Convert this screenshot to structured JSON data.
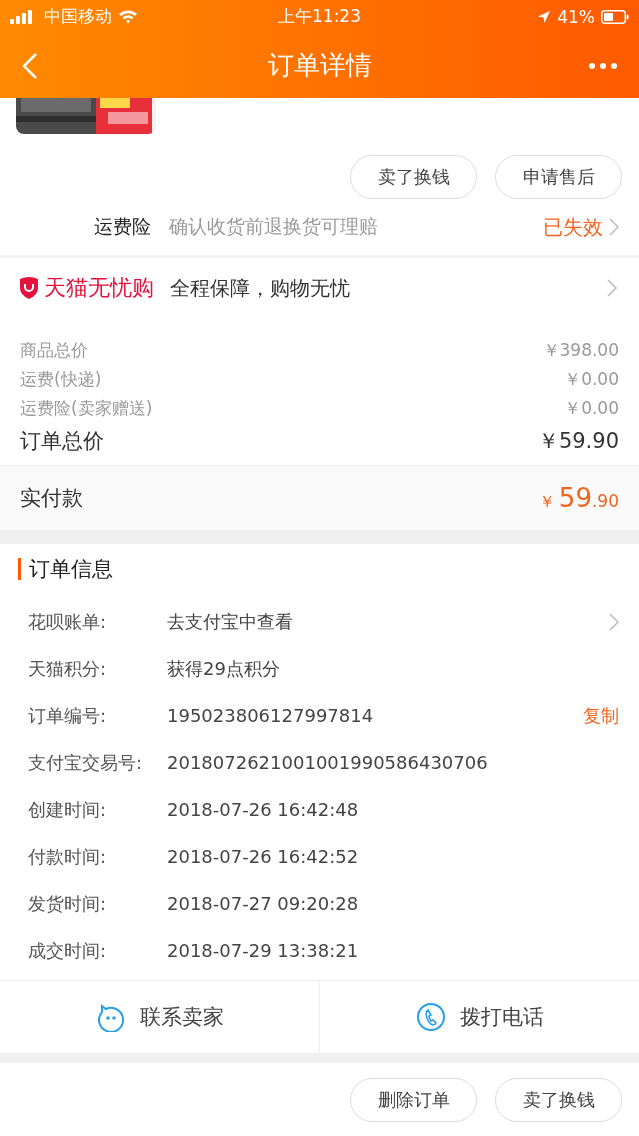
{
  "status_bar": {
    "carrier": "中国移动",
    "time": "上午11:23",
    "battery": "41%"
  },
  "nav": {
    "title": "订单详情"
  },
  "product": {
    "kind": "picture"
  },
  "actions": [
    "卖了换钱",
    "申请售后"
  ],
  "insurance": {
    "label": "运费险",
    "description": "确认收货前退换货可理赔",
    "status": "已失效"
  },
  "guarantee": {
    "brand": "天猫无忧购",
    "slogan": "全程保障，购物无忧"
  },
  "price_lines": [
    {
      "label": "商品总价",
      "value": "￥398.00"
    },
    {
      "label": "运费(快递)",
      "value": "￥0.00"
    },
    {
      "label": "运费险(卖家赠送)",
      "value": "￥0.00"
    }
  ],
  "order_total": {
    "label": "订单总价",
    "value": "￥59.90"
  },
  "paid": {
    "label": "实付款",
    "currency": "￥",
    "integer": "59",
    "decimal": ".90"
  },
  "order_info": {
    "title": "订单信息",
    "rows": [
      {
        "label": "花呗账单:",
        "value": "去支付宝中查看",
        "kind": "link"
      },
      {
        "label": "天猫积分:",
        "value": "获得29点积分",
        "kind": "plain"
      },
      {
        "label": "订单编号:",
        "value": "195023806127997814",
        "kind": "copy",
        "action": "复制"
      },
      {
        "label": "支付宝交易号:",
        "value": "2018072621001001990586430706",
        "kind": "plain"
      },
      {
        "label": "创建时间:",
        "value": "2018-07-26 16:42:48",
        "kind": "plain"
      },
      {
        "label": "付款时间:",
        "value": "2018-07-26 16:42:52",
        "kind": "plain"
      },
      {
        "label": "发货时间:",
        "value": "2018-07-27 09:20:28",
        "kind": "plain"
      },
      {
        "label": "成交时间:",
        "value": "2018-07-29 13:38:21",
        "kind": "plain"
      }
    ]
  },
  "contact": [
    {
      "label": "联系卖家",
      "kind": "chat"
    },
    {
      "label": "拨打电话",
      "kind": "phone"
    }
  ],
  "bottom_actions": [
    "删除订单",
    "卖了换钱"
  ]
}
